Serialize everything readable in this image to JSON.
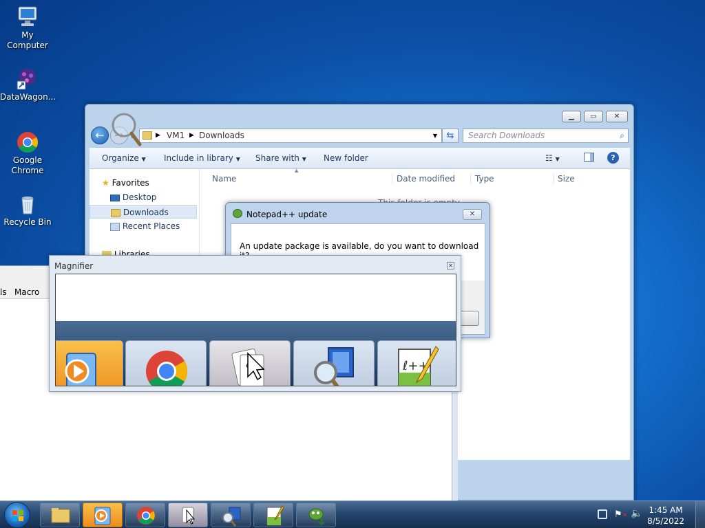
{
  "desktop": {
    "icons": [
      {
        "label": "My Computer",
        "icon": "computer-icon"
      },
      {
        "label": "DataWagon...",
        "icon": "datawagon-shortcut-icon"
      },
      {
        "label": "Google Chrome",
        "icon": "chrome-icon"
      },
      {
        "label": "Recycle Bin",
        "icon": "recycle-bin-icon"
      }
    ]
  },
  "explorer": {
    "breadcrumb": [
      "VM1",
      "Downloads"
    ],
    "search_placeholder": "Search Downloads",
    "toolbar": {
      "organize": "Organize",
      "include_in_library": "Include in library",
      "share_with": "Share with",
      "new_folder": "New folder"
    },
    "nav": {
      "favorites": "Favorites",
      "desktop": "Desktop",
      "downloads": "Downloads",
      "recent_places": "Recent Places",
      "libraries": "Libraries"
    },
    "columns": [
      "Name",
      "Date modified",
      "Type",
      "Size"
    ],
    "empty_text": "This folder is empty."
  },
  "notepad_update": {
    "title": "Notepad++ update",
    "message": "An update package is available, do you want to download it?"
  },
  "notepadpp_window": {
    "menu_fragment_1": "ls",
    "menu_macro": "Macro"
  },
  "magnifier": {
    "title": "Magnifier",
    "tiles": [
      "windows-media-player-icon",
      "chrome-icon",
      "solitaire-icon",
      "magnifier-icon",
      "notepadpp-icon"
    ]
  },
  "taskbar": {
    "items": [
      "start-orb",
      "windows-explorer",
      "windows-media-player",
      "google-chrome",
      "solitaire",
      "magnifier",
      "notepadpp",
      "notepadpp-updater"
    ],
    "time": "1:45 AM",
    "date": "8/5/2022"
  },
  "colors": {
    "accent": "#1e395b",
    "desktop": "#1570cf"
  }
}
